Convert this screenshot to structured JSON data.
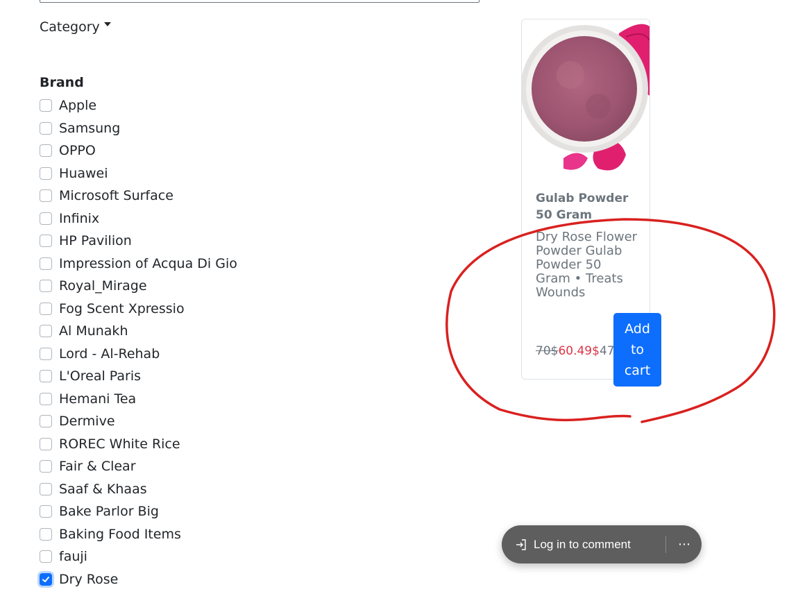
{
  "filters": {
    "category_label": "Category",
    "brand_heading": "Brand",
    "brands": [
      {
        "label": "Apple",
        "checked": false
      },
      {
        "label": "Samsung",
        "checked": false
      },
      {
        "label": "OPPO",
        "checked": false
      },
      {
        "label": "Huawei",
        "checked": false
      },
      {
        "label": "Microsoft Surface",
        "checked": false
      },
      {
        "label": "Infinix",
        "checked": false
      },
      {
        "label": "HP Pavilion",
        "checked": false
      },
      {
        "label": "Impression of Acqua Di Gio",
        "checked": false
      },
      {
        "label": "Royal_Mirage",
        "checked": false
      },
      {
        "label": "Fog Scent Xpressio",
        "checked": false
      },
      {
        "label": "Al Munakh",
        "checked": false
      },
      {
        "label": "Lord - Al-Rehab",
        "checked": false
      },
      {
        "label": "L'Oreal Paris",
        "checked": false
      },
      {
        "label": "Hemani Tea",
        "checked": false
      },
      {
        "label": "Dermive",
        "checked": false
      },
      {
        "label": "ROREC White Rice",
        "checked": false
      },
      {
        "label": "Fair & Clear",
        "checked": false
      },
      {
        "label": "Saaf & Khaas",
        "checked": false
      },
      {
        "label": "Bake Parlor Big",
        "checked": false
      },
      {
        "label": "Baking Food Items",
        "checked": false
      },
      {
        "label": "fauji",
        "checked": false
      },
      {
        "label": "Dry Rose",
        "checked": true
      }
    ]
  },
  "product": {
    "title": "Gulab Powder 50 Gram",
    "description": "Dry Rose Flower Powder Gulab Powder 50 Gram • Treats Wounds",
    "old_price": "70$",
    "sale_price": "60.49$",
    "extra_price": "47",
    "add_to_cart_label": "Add to cart",
    "image_icon": "rose-powder-bowl-image"
  },
  "comment_bar": {
    "login_label": "Log in to comment",
    "login_icon": "sign-in-icon",
    "more_icon": "more-dots-icon"
  },
  "colors": {
    "primary": "#0d6efd",
    "sale": "#dc3545",
    "annotation": "#d9211f"
  }
}
